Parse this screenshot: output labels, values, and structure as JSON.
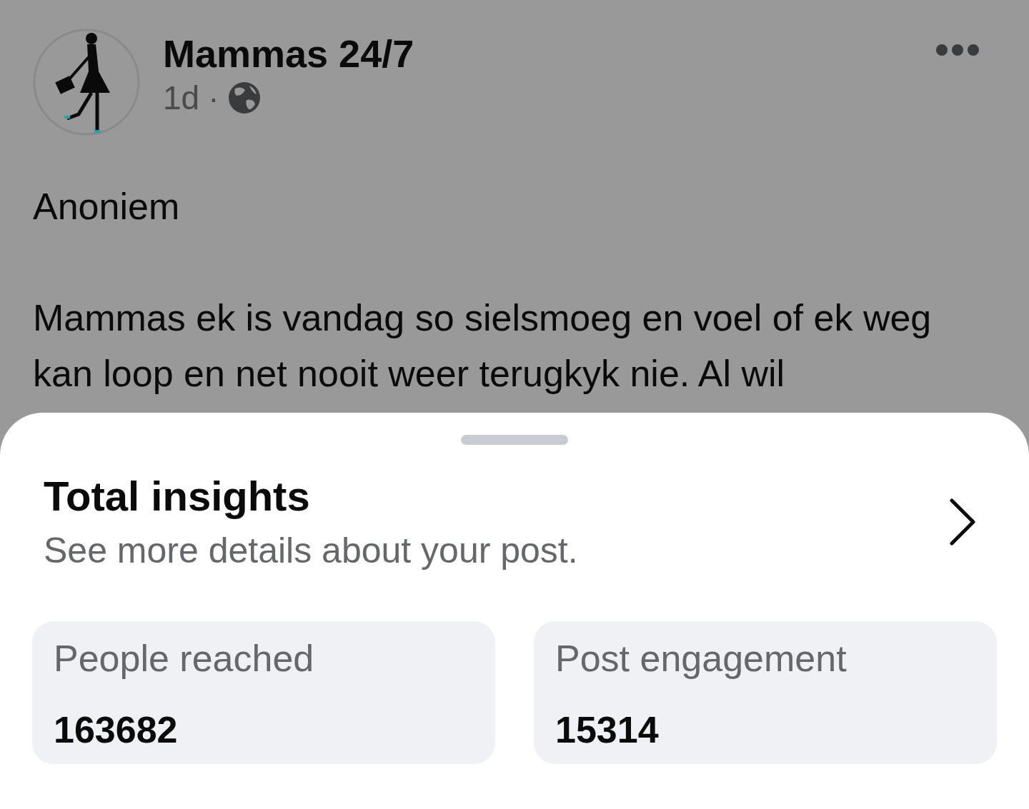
{
  "post": {
    "author": "Mammas 24/7",
    "time": "1d",
    "separator": "·",
    "paragraphs": [
      "Anoniem",
      "Mammas ek is vandag so sielsmoeg en voel of ek weg kan loop en net nooit weer terugkyk nie. Al wil"
    ]
  },
  "sheet": {
    "title": "Total insights",
    "subtitle": "See more details about your post.",
    "stats": [
      {
        "label": "People reached",
        "value": "163682"
      },
      {
        "label": "Post engagement",
        "value": "15314"
      }
    ]
  }
}
